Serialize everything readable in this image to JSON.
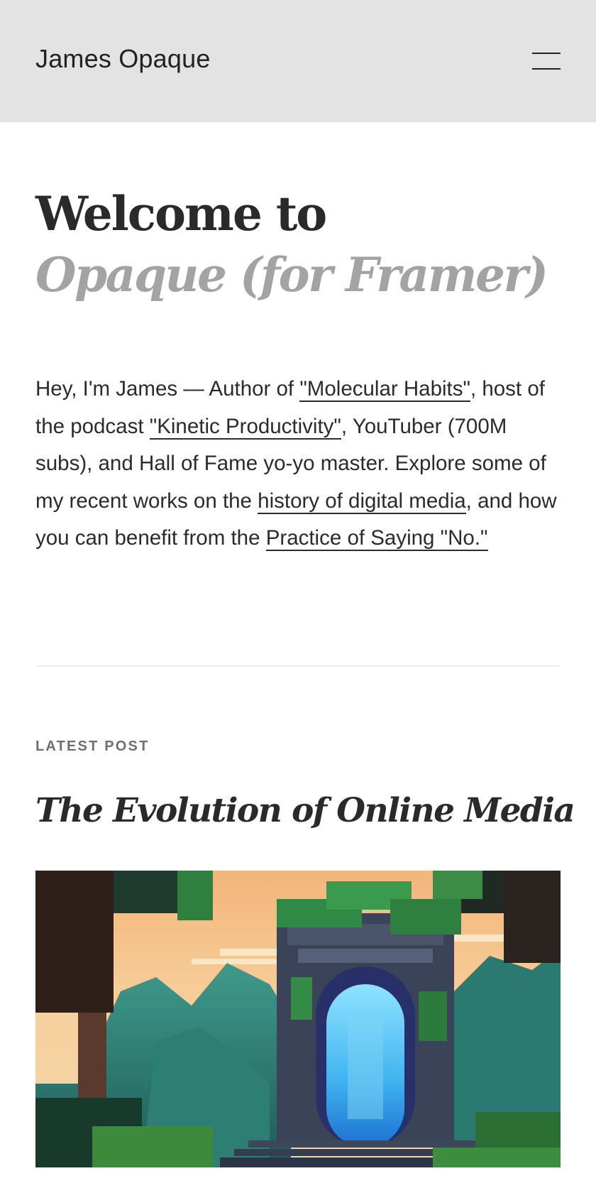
{
  "header": {
    "site_title": "James Opaque",
    "menu_icon": "hamburger-menu-icon"
  },
  "hero": {
    "line1": "Welcome to",
    "line2": "Opaque (for Framer)"
  },
  "intro": {
    "text1": "Hey, I'm James — Author of ",
    "link1": "\"Molecular Habits\"",
    "text2": ", host of the podcast ",
    "link2": "\"Kinetic Productivity\"",
    "text3": ", YouTuber (700M subs), and Hall of Fame yo-yo master. Explore some of my recent works on the ",
    "link3": "history of digital media",
    "text4": ", and how you can benefit from the ",
    "link4": "Practice of Saying \"No.\""
  },
  "latest": {
    "label": "LATEST POST",
    "title": "The Evolution of Online Media",
    "image_icon": "pixel-art-ruined-portal-image"
  },
  "colors": {
    "header_bg": "#e3e3e3",
    "text": "#2b2b2b",
    "muted_heading": "#a3a3a3",
    "label": "#6f6f6f"
  }
}
